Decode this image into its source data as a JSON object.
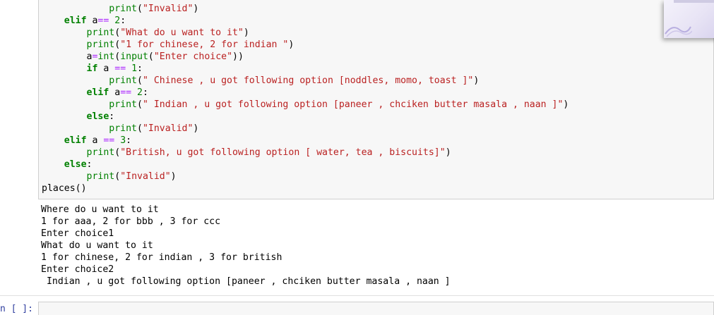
{
  "code_lines": [
    [
      {
        "t": "            "
      },
      {
        "c": "builtin",
        "t": "print"
      },
      {
        "t": "("
      },
      {
        "c": "str",
        "t": "\"Invalid\""
      },
      {
        "t": ")"
      }
    ],
    [
      {
        "t": "    "
      },
      {
        "c": "kw",
        "t": "elif"
      },
      {
        "t": " a"
      },
      {
        "c": "op",
        "t": "=="
      },
      {
        "t": " "
      },
      {
        "c": "num",
        "t": "2"
      },
      {
        "t": ":"
      }
    ],
    [
      {
        "t": "        "
      },
      {
        "c": "builtin",
        "t": "print"
      },
      {
        "t": "("
      },
      {
        "c": "str",
        "t": "\"What do u want to it\""
      },
      {
        "t": ")"
      }
    ],
    [
      {
        "t": "        "
      },
      {
        "c": "builtin",
        "t": "print"
      },
      {
        "t": "("
      },
      {
        "c": "str",
        "t": "\"1 for chinese, 2 for indian \""
      },
      {
        "t": ")"
      }
    ],
    [
      {
        "t": "        a"
      },
      {
        "c": "op",
        "t": "="
      },
      {
        "c": "builtin",
        "t": "int"
      },
      {
        "t": "("
      },
      {
        "c": "builtin",
        "t": "input"
      },
      {
        "t": "("
      },
      {
        "c": "str",
        "t": "\"Enter choice\""
      },
      {
        "t": "))"
      }
    ],
    [
      {
        "t": "        "
      },
      {
        "c": "kw",
        "t": "if"
      },
      {
        "t": " a "
      },
      {
        "c": "op",
        "t": "=="
      },
      {
        "t": " "
      },
      {
        "c": "num",
        "t": "1"
      },
      {
        "t": ":"
      }
    ],
    [
      {
        "t": "            "
      },
      {
        "c": "builtin",
        "t": "print"
      },
      {
        "t": "("
      },
      {
        "c": "str",
        "t": "\" Chinese , u got following option [noddles, momo, toast ]\""
      },
      {
        "t": ")"
      }
    ],
    [
      {
        "t": "        "
      },
      {
        "c": "kw",
        "t": "elif"
      },
      {
        "t": " a"
      },
      {
        "c": "op",
        "t": "=="
      },
      {
        "t": " "
      },
      {
        "c": "num",
        "t": "2"
      },
      {
        "t": ":"
      }
    ],
    [
      {
        "t": "            "
      },
      {
        "c": "builtin",
        "t": "print"
      },
      {
        "t": "("
      },
      {
        "c": "str",
        "t": "\" Indian , u got following option [paneer , chciken butter masala , naan ]\""
      },
      {
        "t": ")"
      }
    ],
    [
      {
        "t": "        "
      },
      {
        "c": "kw",
        "t": "else"
      },
      {
        "t": ":"
      }
    ],
    [
      {
        "t": "            "
      },
      {
        "c": "builtin",
        "t": "print"
      },
      {
        "t": "("
      },
      {
        "c": "str",
        "t": "\"Invalid\""
      },
      {
        "t": ")"
      }
    ],
    [
      {
        "t": "    "
      },
      {
        "c": "kw",
        "t": "elif"
      },
      {
        "t": " a "
      },
      {
        "c": "op",
        "t": "=="
      },
      {
        "t": " "
      },
      {
        "c": "num",
        "t": "3"
      },
      {
        "t": ":"
      }
    ],
    [
      {
        "t": "        "
      },
      {
        "c": "builtin",
        "t": "print"
      },
      {
        "t": "("
      },
      {
        "c": "str",
        "t": "\"British, u got following option [ water, tea , biscuits]\""
      },
      {
        "t": ")"
      }
    ],
    [
      {
        "t": "    "
      },
      {
        "c": "kw",
        "t": "else"
      },
      {
        "t": ":"
      }
    ],
    [
      {
        "t": "        "
      },
      {
        "c": "builtin",
        "t": "print"
      },
      {
        "t": "("
      },
      {
        "c": "str",
        "t": "\"Invalid\""
      },
      {
        "t": ")"
      }
    ],
    [
      {
        "t": "places()"
      }
    ]
  ],
  "output_lines": [
    "Where do u want to it",
    "1 for aaa, 2 for bbb , 3 for ccc",
    "Enter choice1",
    "What do u want to it",
    "1 for chinese, 2 for indian , 3 for british",
    "Enter choice2",
    " Indian , u got following option [paneer , chciken butter masala , naan ]"
  ],
  "prompt_label": "n [ ]:",
  "colors": {
    "keyword": "#008000",
    "string": "#ba2121",
    "operator": "#aa22ff",
    "cell_background": "#f7f7f7",
    "prompt": "#303f9f"
  }
}
